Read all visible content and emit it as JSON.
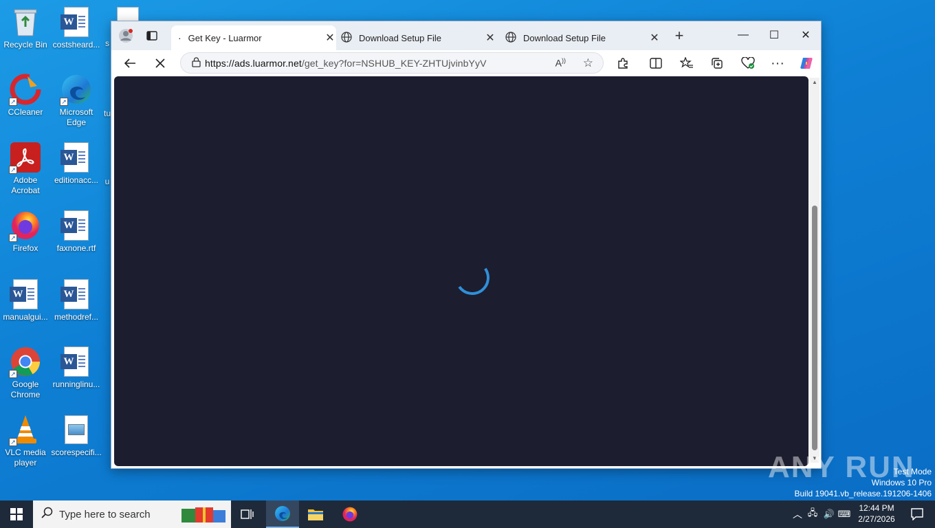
{
  "desktop": {
    "icons": [
      {
        "label": "Recycle Bin",
        "icon": "recycle-bin-icon"
      },
      {
        "label": "costsheard...",
        "icon": "word-document-icon"
      },
      {
        "label": "CCleaner",
        "icon": "ccleaner-icon"
      },
      {
        "label": "Microsoft Edge",
        "icon": "edge-icon"
      },
      {
        "label": "Adobe Acrobat",
        "icon": "acrobat-icon"
      },
      {
        "label": "editionacc...",
        "icon": "word-document-icon"
      },
      {
        "label": "Firefox",
        "icon": "firefox-icon"
      },
      {
        "label": "faxnone.rtf",
        "icon": "word-document-icon"
      },
      {
        "label": "manualgui...",
        "icon": "word-document-icon"
      },
      {
        "label": "methodref...",
        "icon": "word-document-icon"
      },
      {
        "label": "Google Chrome",
        "icon": "chrome-icon"
      },
      {
        "label": "runninglinu...",
        "icon": "word-document-icon"
      },
      {
        "label": "VLC media player",
        "icon": "vlc-icon"
      },
      {
        "label": "scorespecifi...",
        "icon": "image-document-icon"
      }
    ],
    "partial_labels": [
      "s",
      "tu",
      "u"
    ]
  },
  "browser": {
    "tabs": [
      {
        "title": "Get Key - Luarmor",
        "active": true
      },
      {
        "title": "Download Setup File",
        "active": false
      },
      {
        "title": "Download Setup File",
        "active": false
      }
    ],
    "address": {
      "host": "https://ads.luarmor.net",
      "path": "/get_key?for=NSHUB_KEY-ZHTUjvinbYyV"
    },
    "page_state": "loading"
  },
  "watermark": {
    "brand": "ANY RUN",
    "lines": [
      "Test Mode",
      "Windows 10 Pro",
      "Build 19041.vb_release.191206-1406"
    ]
  },
  "taskbar": {
    "search_placeholder": "Type here to search",
    "time": "12:44 PM",
    "date": "2/27/2026"
  }
}
